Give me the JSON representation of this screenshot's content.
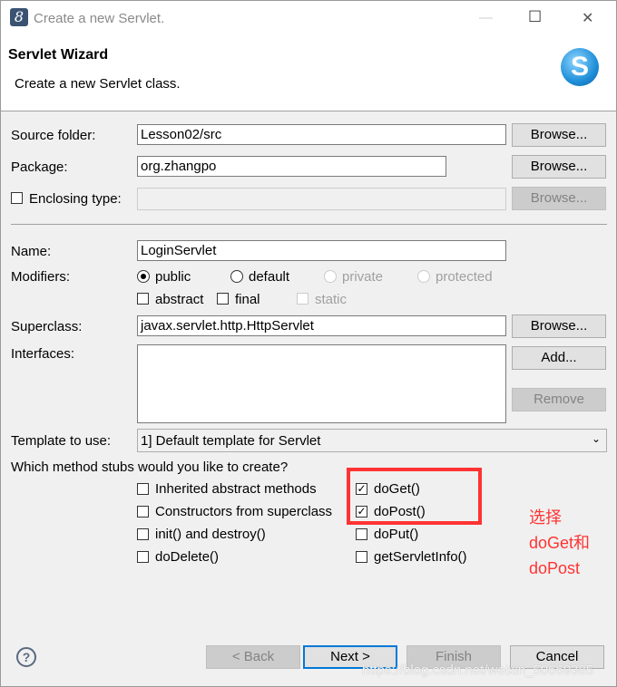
{
  "window": {
    "title": "Create a new Servlet.",
    "minimize": "—",
    "maximize": "☐",
    "close": "✕"
  },
  "header": {
    "title": "Servlet Wizard",
    "subtitle": "Create a new Servlet class.",
    "logo_letter": "S"
  },
  "form": {
    "source_folder": {
      "label": "Source folder:",
      "value": "Lesson02/src",
      "button": "Browse..."
    },
    "package": {
      "label": "Package:",
      "value": "org.zhangpo",
      "button": "Browse..."
    },
    "enclosing": {
      "label": "Enclosing type:",
      "value": "",
      "button": "Browse...",
      "checked": false
    },
    "name": {
      "label": "Name:",
      "value": "LoginServlet"
    },
    "modifiers": {
      "label": "Modifiers:",
      "radios": [
        {
          "label": "public",
          "selected": true,
          "enabled": true
        },
        {
          "label": "default",
          "selected": false,
          "enabled": true
        },
        {
          "label": "private",
          "selected": false,
          "enabled": false
        },
        {
          "label": "protected",
          "selected": false,
          "enabled": false
        }
      ],
      "checks": [
        {
          "label": "abstract",
          "checked": false,
          "enabled": true
        },
        {
          "label": "final",
          "checked": false,
          "enabled": true
        },
        {
          "label": "static",
          "checked": false,
          "enabled": false
        }
      ]
    },
    "superclass": {
      "label": "Superclass:",
      "value": "javax.servlet.http.HttpServlet",
      "button": "Browse..."
    },
    "interfaces": {
      "label": "Interfaces:",
      "add": "Add...",
      "remove": "Remove"
    },
    "template": {
      "label": "Template to use:",
      "value": "1] Default template for Servlet"
    },
    "stubs": {
      "question": "Which method stubs would you like to create?",
      "items": [
        {
          "label": "Inherited abstract methods",
          "checked": false
        },
        {
          "label": "doGet()",
          "checked": true
        },
        {
          "label": "Constructors from superclass",
          "checked": false
        },
        {
          "label": "doPost()",
          "checked": true
        },
        {
          "label": "init() and destroy()",
          "checked": false
        },
        {
          "label": "doPut()",
          "checked": false
        },
        {
          "label": "doDelete()",
          "checked": false
        },
        {
          "label": "getServletInfo()",
          "checked": false
        }
      ]
    }
  },
  "annotation": {
    "color": "#ff3333",
    "lines": [
      "选择",
      "doGet和",
      "doPost"
    ]
  },
  "footer": {
    "help": "?",
    "back": "< Back",
    "next": "Next >",
    "finish": "Finish",
    "cancel": "Cancel"
  },
  "watermark": "https://blog.csdn.net/weixin_50669385"
}
